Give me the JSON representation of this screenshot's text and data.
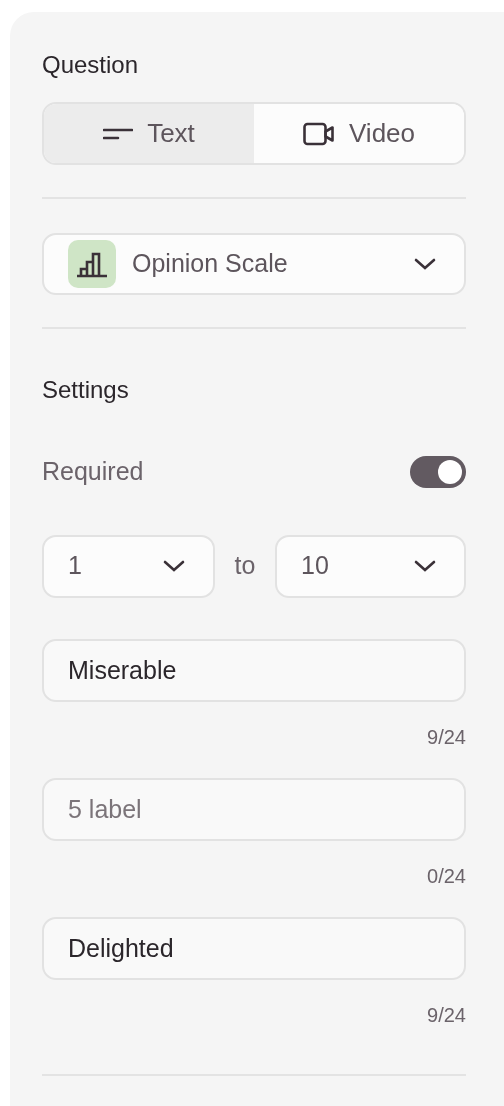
{
  "question": {
    "heading": "Question",
    "modes": [
      {
        "kind": "text",
        "label": "Text",
        "selected": true
      },
      {
        "kind": "video",
        "label": "Video",
        "selected": false
      }
    ],
    "type_select": {
      "label": "Opinion Scale"
    }
  },
  "settings": {
    "heading": "Settings",
    "required": {
      "label": "Required",
      "on": true
    },
    "range": {
      "from": "1",
      "separator": "to",
      "to": "10"
    },
    "labels": [
      {
        "value": "Miserable",
        "counter": "9/24"
      },
      {
        "placeholder": "5 label",
        "counter": "0/24"
      },
      {
        "value": "Delighted",
        "counter": "9/24"
      }
    ]
  }
}
